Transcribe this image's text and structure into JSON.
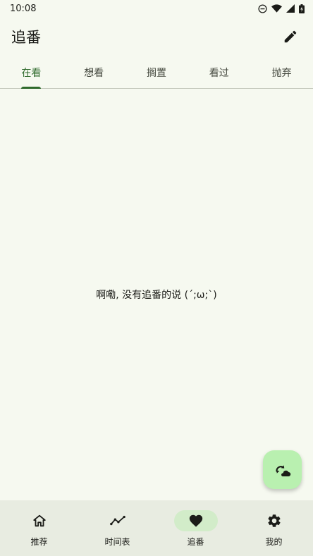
{
  "status_bar": {
    "time": "10:08",
    "icons": [
      "dnd-icon",
      "wifi-icon",
      "signal-icon",
      "battery-icon"
    ]
  },
  "app_bar": {
    "title": "追番",
    "action_icon": "edit-icon"
  },
  "tabs": [
    {
      "label": "在看",
      "active": true
    },
    {
      "label": "想看",
      "active": false
    },
    {
      "label": "搁置",
      "active": false
    },
    {
      "label": "看过",
      "active": false
    },
    {
      "label": "抛弃",
      "active": false
    }
  ],
  "empty_message": "啊嘞, 没有追番的说 (´;ω;`)",
  "fab": {
    "icon": "sync-cloud-icon"
  },
  "bottom_nav": [
    {
      "label": "推荐",
      "icon": "home-icon",
      "active": false
    },
    {
      "label": "时间表",
      "icon": "timeline-icon",
      "active": false
    },
    {
      "label": "追番",
      "icon": "heart-icon",
      "active": true
    },
    {
      "label": "我的",
      "icon": "gear-icon",
      "active": false
    }
  ],
  "colors": {
    "background": "#f6f9f0",
    "accent": "#2f6a2c",
    "fab": "#b9f0b0",
    "nav_bg": "#e8ece1",
    "nav_active_pill": "#d2ecc9"
  }
}
